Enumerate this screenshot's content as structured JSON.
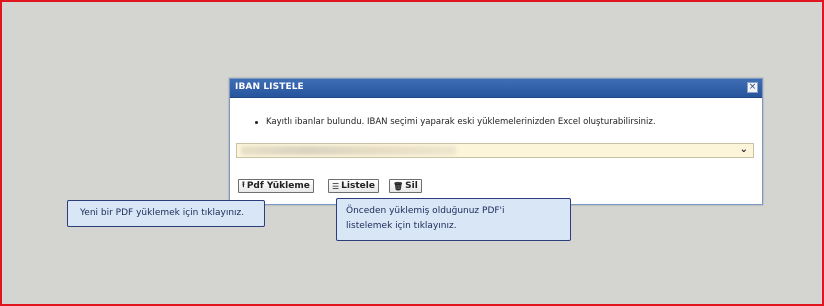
{
  "dialog": {
    "title": "IBAN LISTELE",
    "close_symbol": "×",
    "info_text": "Kayıtlı ibanlar bulundu. IBAN seçimi yaparak eski yüklemelerinizden Excel oluşturabilirsiniz.",
    "select_chevron": "⌄",
    "buttons": {
      "upload_icon": "⭱",
      "upload_label": "Pdf Yükleme",
      "list_icon": "☰",
      "list_label": "Listele",
      "delete_icon": "🗑",
      "delete_label": "Sil"
    }
  },
  "tooltips": {
    "upload_hint": "Yeni bir PDF yüklemek için tıklayınız.",
    "list_hint_line1": "Önceden yüklemiş olduğunuz PDF'i",
    "list_hint_line2": "listelemek için tıklayınız."
  },
  "colors": {
    "frame_border": "#e0151d",
    "dialog_header": "#2f5fa8",
    "select_background": "#fdf5da",
    "tooltip_background": "#d8e6f5"
  }
}
